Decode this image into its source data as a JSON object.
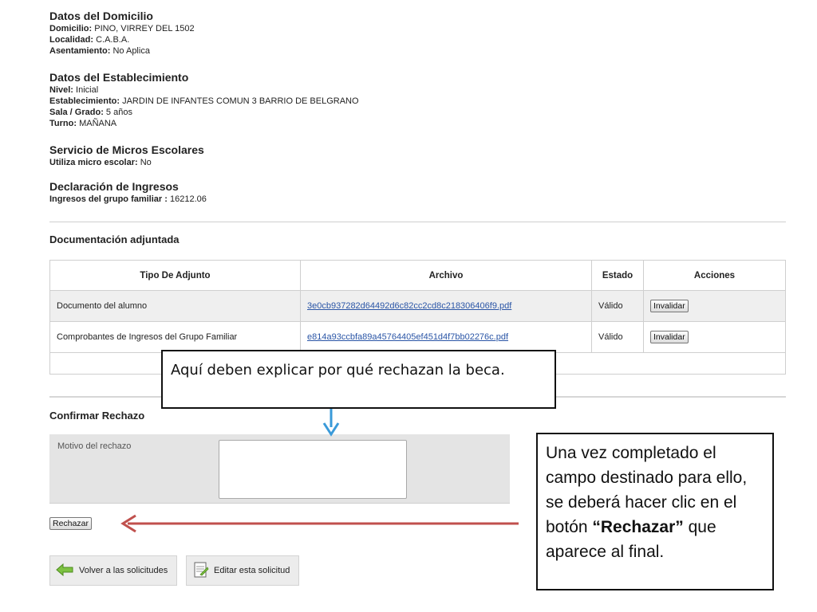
{
  "domicilio": {
    "title": "Datos del Domicilio",
    "fields": [
      {
        "label": "Domicilio:",
        "value": "PINO, VIRREY DEL 1502"
      },
      {
        "label": "Localidad:",
        "value": "C.A.B.A."
      },
      {
        "label": "Asentamiento:",
        "value": "No Aplica"
      }
    ]
  },
  "establecimiento": {
    "title": "Datos del Establecimiento",
    "fields": [
      {
        "label": "Nivel:",
        "value": "Inicial"
      },
      {
        "label": "Establecimiento:",
        "value": "JARDIN DE INFANTES COMUN 3 BARRIO DE BELGRANO"
      },
      {
        "label": "Sala / Grado:",
        "value": "5 años"
      },
      {
        "label": "Turno:",
        "value": "MAÑANA"
      }
    ]
  },
  "micros": {
    "title": "Servicio de Micros Escolares",
    "fields": [
      {
        "label": "Utiliza micro escolar:",
        "value": "No"
      }
    ]
  },
  "ingresos": {
    "title": "Declaración de Ingresos",
    "fields": [
      {
        "label": "Ingresos del grupo familiar :",
        "value": "16212.06"
      }
    ]
  },
  "documentacion": {
    "title": "Documentación adjuntada",
    "headers": [
      "Tipo De Adjunto",
      "Archivo",
      "Estado",
      "Acciones"
    ],
    "rows": [
      {
        "tipo": "Documento del alumno",
        "archivo": "3e0cb937282d64492d6c82cc2cd8c218306406f9.pdf",
        "estado": "Válido",
        "accion": "Invalidar"
      },
      {
        "tipo": "Comprobantes de Ingresos del Grupo Familiar",
        "archivo": "e814a93ccbfa89a45764405ef451d4f7bb02276c.pdf",
        "estado": "Válido",
        "accion": "Invalidar"
      }
    ]
  },
  "rechazo": {
    "title": "Confirmar Rechazo",
    "label": "Motivo del rechazo",
    "textarea_value": "",
    "button": "Rechazar"
  },
  "bottom_buttons": {
    "volver": "Volver a las solicitudes",
    "editar": "Editar esta solicitud"
  },
  "callouts": {
    "callout1": "Aquí deben explicar por qué rechazan la beca.",
    "callout2_pre": "Una vez completado el campo destinado para ello, se deberá hacer clic en el botón ",
    "callout2_bold": "“Rechazar”",
    "callout2_post": " que aparece al final."
  },
  "colors": {
    "link": "#2a55a6",
    "arrow_blue": "#3a9ad9",
    "arrow_red": "#c0504d"
  }
}
